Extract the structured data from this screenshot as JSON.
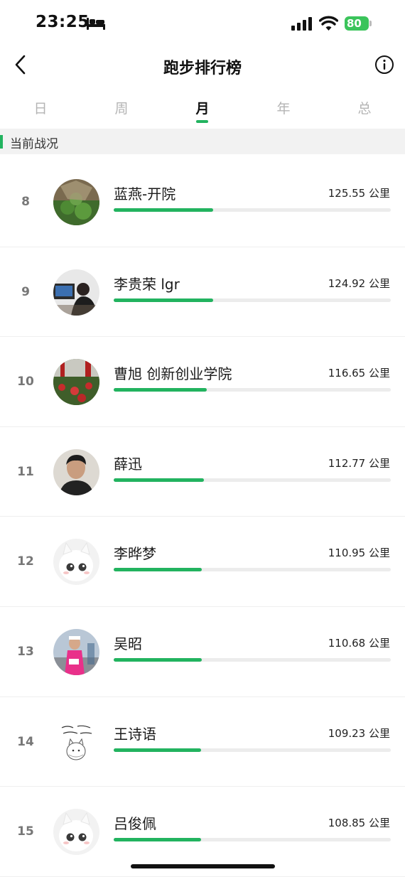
{
  "status_bar": {
    "time": "23:25",
    "battery": "80"
  },
  "header": {
    "title": "跑步排行榜"
  },
  "tabs": [
    {
      "label": "日",
      "active": false
    },
    {
      "label": "周",
      "active": false
    },
    {
      "label": "月",
      "active": true
    },
    {
      "label": "年",
      "active": false
    },
    {
      "label": "总",
      "active": false
    }
  ],
  "section": {
    "title": "当前战况"
  },
  "colors": {
    "accent": "#22b35f",
    "track": "#ececec"
  },
  "rankings": [
    {
      "rank": "8",
      "name": "蓝燕-开院",
      "distance": "125.55 公里",
      "progress": 0.36,
      "avatar": "garden-photo-avatar"
    },
    {
      "rank": "9",
      "name": "李贵荣 lgr",
      "distance": "124.92 公里",
      "progress": 0.36,
      "avatar": "office-photo-avatar"
    },
    {
      "rank": "10",
      "name": "曹旭 创新创业学院",
      "distance": "116.65 公里",
      "progress": 0.335,
      "avatar": "flowerbed-photo-avatar"
    },
    {
      "rank": "11",
      "name": "薛迅",
      "distance": "112.77 公里",
      "progress": 0.325,
      "avatar": "portrait-photo-avatar"
    },
    {
      "rank": "12",
      "name": "李晔梦",
      "distance": "110.95 公里",
      "progress": 0.318,
      "avatar": "default-cartoon-avatar"
    },
    {
      "rank": "13",
      "name": "吴昭",
      "distance": "110.68 公里",
      "progress": 0.318,
      "avatar": "runner-photo-avatar"
    },
    {
      "rank": "14",
      "name": "王诗语",
      "distance": "109.23 公里",
      "progress": 0.315,
      "avatar": "sketch-cat-avatar"
    },
    {
      "rank": "15",
      "name": "吕俊佩",
      "distance": "108.85 公里",
      "progress": 0.315,
      "avatar": "default-cartoon-avatar"
    }
  ]
}
